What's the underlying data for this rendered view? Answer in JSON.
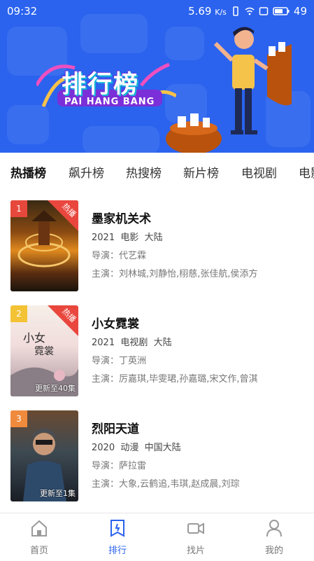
{
  "status_bar": {
    "time": "09:32",
    "speed": "5.69",
    "speed_unit": "K/s",
    "battery": "49"
  },
  "hero": {
    "title": "排行榜",
    "subtitle": "PAI HANG BANG"
  },
  "tabs": [
    "热播榜",
    "飙升榜",
    "热搜榜",
    "新片榜",
    "电视剧",
    "电影"
  ],
  "active_tab": "热播榜",
  "list": [
    {
      "rank": "1",
      "hot_label": "热播",
      "update": "",
      "title": "墨家机关术",
      "year": "2021",
      "type": "电影",
      "region": "大陆",
      "director": "导演：代艺霖",
      "cast": "主演：刘林城,刘静怡,栩慈,张佳航,侯添方"
    },
    {
      "rank": "2",
      "hot_label": "热播",
      "update": "更新至40集",
      "title": "小女霓裳",
      "year": "2021",
      "type": "电视剧",
      "region": "大陆",
      "director": "导演：丁英洲",
      "cast": "主演：厉嘉琪,毕雯珺,孙嘉璐,宋文作,曾淇"
    },
    {
      "rank": "3",
      "hot_label": "",
      "update": "更新至1集",
      "title": "烈阳天道",
      "year": "2020",
      "type": "动漫",
      "region": "中国大陆",
      "director": "导演：萨拉雷",
      "cast": "主演：大象,云鹤追,韦琪,赵成晨,刘琮"
    }
  ],
  "bottom_nav": [
    {
      "label": "首页",
      "icon": "home-icon"
    },
    {
      "label": "排行",
      "icon": "ranking-icon"
    },
    {
      "label": "找片",
      "icon": "video-camera-icon"
    },
    {
      "label": "我的",
      "icon": "user-icon"
    }
  ],
  "colors": {
    "brand": "#2b63ee",
    "hot": "#e9473e",
    "rank1": "#e6483b",
    "rank2": "#f3c235",
    "rank3": "#f08a3c"
  }
}
